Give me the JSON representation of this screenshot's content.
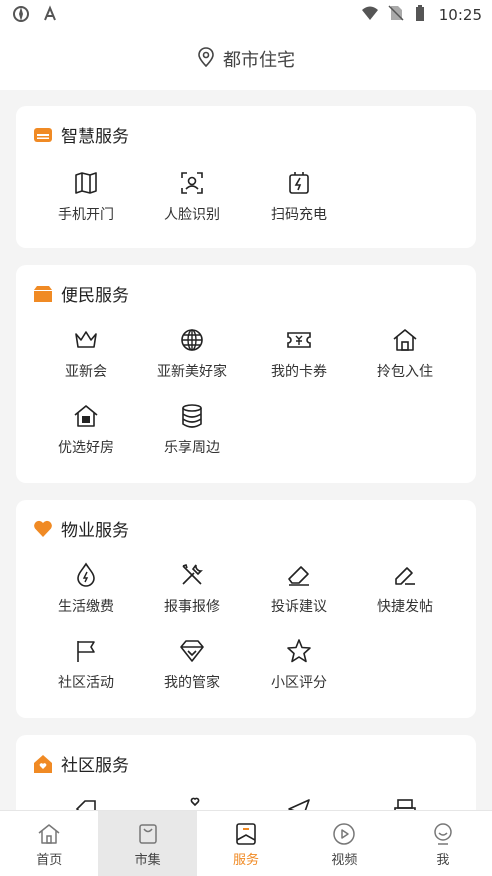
{
  "status_bar": {
    "time": "10:25"
  },
  "header": {
    "location": "都市住宅"
  },
  "sections": [
    {
      "title": "智慧服务",
      "items": [
        {
          "label": "手机开门",
          "icon": "map-icon"
        },
        {
          "label": "人脸识别",
          "icon": "face-scan-icon"
        },
        {
          "label": "扫码充电",
          "icon": "charge-icon"
        }
      ]
    },
    {
      "title": "便民服务",
      "items": [
        {
          "label": "亚新会",
          "icon": "crown-icon"
        },
        {
          "label": "亚新美好家",
          "icon": "globe-icon"
        },
        {
          "label": "我的卡券",
          "icon": "ticket-icon"
        },
        {
          "label": "拎包入住",
          "icon": "house-icon"
        },
        {
          "label": "优选好房",
          "icon": "rent-house-icon"
        },
        {
          "label": "乐享周边",
          "icon": "database-icon"
        }
      ]
    },
    {
      "title": "物业服务",
      "items": [
        {
          "label": "生活缴费",
          "icon": "water-drop-icon"
        },
        {
          "label": "报事报修",
          "icon": "tools-icon"
        },
        {
          "label": "投诉建议",
          "icon": "eraser-icon"
        },
        {
          "label": "快捷发帖",
          "icon": "edit-icon"
        },
        {
          "label": "社区活动",
          "icon": "flag-icon"
        },
        {
          "label": "我的管家",
          "icon": "diamond-icon"
        },
        {
          "label": "小区评分",
          "icon": "star-icon"
        }
      ]
    },
    {
      "title": "社区服务"
    }
  ],
  "tabs": [
    {
      "label": "首页",
      "icon": "home-icon"
    },
    {
      "label": "市集",
      "icon": "bag-icon"
    },
    {
      "label": "服务",
      "icon": "service-icon"
    },
    {
      "label": "视频",
      "icon": "play-icon"
    },
    {
      "label": "我",
      "icon": "profile-icon"
    }
  ],
  "colors": {
    "accent": "#f08a24",
    "background": "#f4f4f4",
    "card": "#ffffff"
  }
}
